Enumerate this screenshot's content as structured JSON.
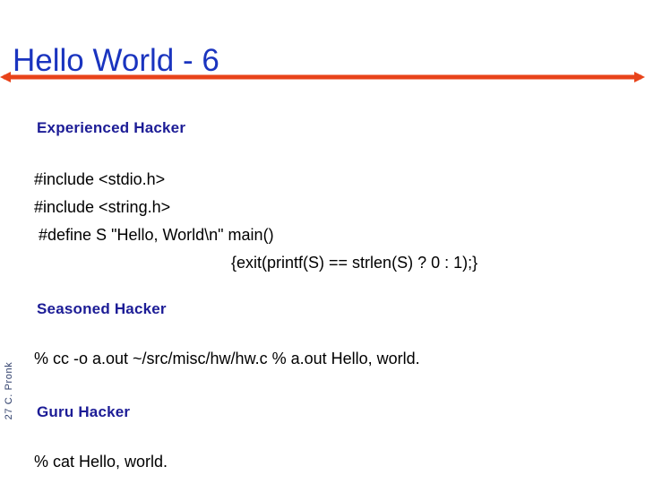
{
  "slide": {
    "title": "Hello World - 6",
    "title_color": "#1a34bf",
    "rule_color": "#e8431a",
    "heading_color": "#1c1c96",
    "body_color": "#000000",
    "background_color": "#ffffff"
  },
  "sections": {
    "experienced": {
      "heading": "Experienced Hacker",
      "code": [
        "#include <stdio.h>",
        "#include <string.h>",
        " #define S \"Hello, World\\n\" main()",
        "{exit(printf(S) == strlen(S) ? 0 : 1);}"
      ]
    },
    "seasoned": {
      "heading": "Seasoned Hacker",
      "shell": "% cc -o a.out ~/src/misc/hw/hw.c % a.out Hello, world."
    },
    "guru": {
      "heading": "Guru Hacker",
      "shell": "% cat Hello, world."
    }
  },
  "footer": {
    "credit": "27 C. Pronk"
  },
  "icons": {
    "rule": "double-arrow-rule-icon"
  }
}
